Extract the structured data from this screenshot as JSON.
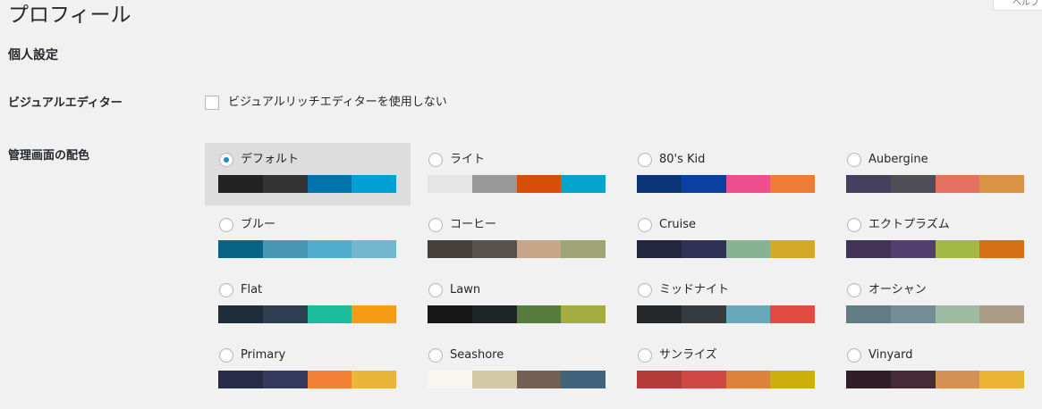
{
  "page": {
    "title": "プロフィール",
    "help_tab": "ヘルプ"
  },
  "section": {
    "title": "個人設定"
  },
  "visual_editor": {
    "label": "ビジュアルエディター",
    "checkbox_label": "ビジュアルリッチエディターを使用しない",
    "checked": false
  },
  "admin_color": {
    "label": "管理画面の配色",
    "selected": "デフォルト",
    "schemes": [
      {
        "name": "デフォルト",
        "colors": [
          "#222222",
          "#333333",
          "#0073aa",
          "#00a0d2"
        ]
      },
      {
        "name": "ライト",
        "colors": [
          "#e5e5e5",
          "#999999",
          "#d64e07",
          "#04a4cc"
        ]
      },
      {
        "name": "80's Kid",
        "colors": [
          "#0a3576",
          "#0b3fa2",
          "#ef4f8f",
          "#ef7c34"
        ]
      },
      {
        "name": "Aubergine",
        "colors": [
          "#433f5c",
          "#4e4e56",
          "#e4705f",
          "#d89444"
        ]
      },
      {
        "name": "ブルー",
        "colors": [
          "#096484",
          "#4796b3",
          "#52accc",
          "#74b6ce"
        ]
      },
      {
        "name": "コーヒー",
        "colors": [
          "#46403c",
          "#59524c",
          "#c7a589",
          "#9ea476"
        ]
      },
      {
        "name": "Cruise",
        "colors": [
          "#242640",
          "#2f3155",
          "#87b393",
          "#d4a928"
        ]
      },
      {
        "name": "エクトプラズム",
        "colors": [
          "#413256",
          "#523f6d",
          "#a3b745",
          "#d46f15"
        ]
      },
      {
        "name": "Flat",
        "colors": [
          "#1f2c39",
          "#2c3e50",
          "#1abc9c",
          "#f39c12"
        ]
      },
      {
        "name": "Lawn",
        "colors": [
          "#161818",
          "#1f2527",
          "#567b3d",
          "#a3ad40"
        ]
      },
      {
        "name": "ミッドナイト",
        "colors": [
          "#25282b",
          "#363b3f",
          "#69a8bb",
          "#e14d43"
        ]
      },
      {
        "name": "オーシャン",
        "colors": [
          "#627c83",
          "#738e96",
          "#9ebaa0",
          "#aa9d88"
        ]
      },
      {
        "name": "Primary",
        "colors": [
          "#282b48",
          "#35395c",
          "#f38135",
          "#e9b637"
        ]
      },
      {
        "name": "Seashore",
        "colors": [
          "#f8f6f1",
          "#d1c9a8",
          "#736052",
          "#41637c"
        ]
      },
      {
        "name": "サンライズ",
        "colors": [
          "#b43c38",
          "#cf4944",
          "#dd823b",
          "#ccaf0b"
        ]
      },
      {
        "name": "Vinyard",
        "colors": [
          "#301d25",
          "#462b37",
          "#d39254",
          "#eab532"
        ]
      }
    ]
  }
}
